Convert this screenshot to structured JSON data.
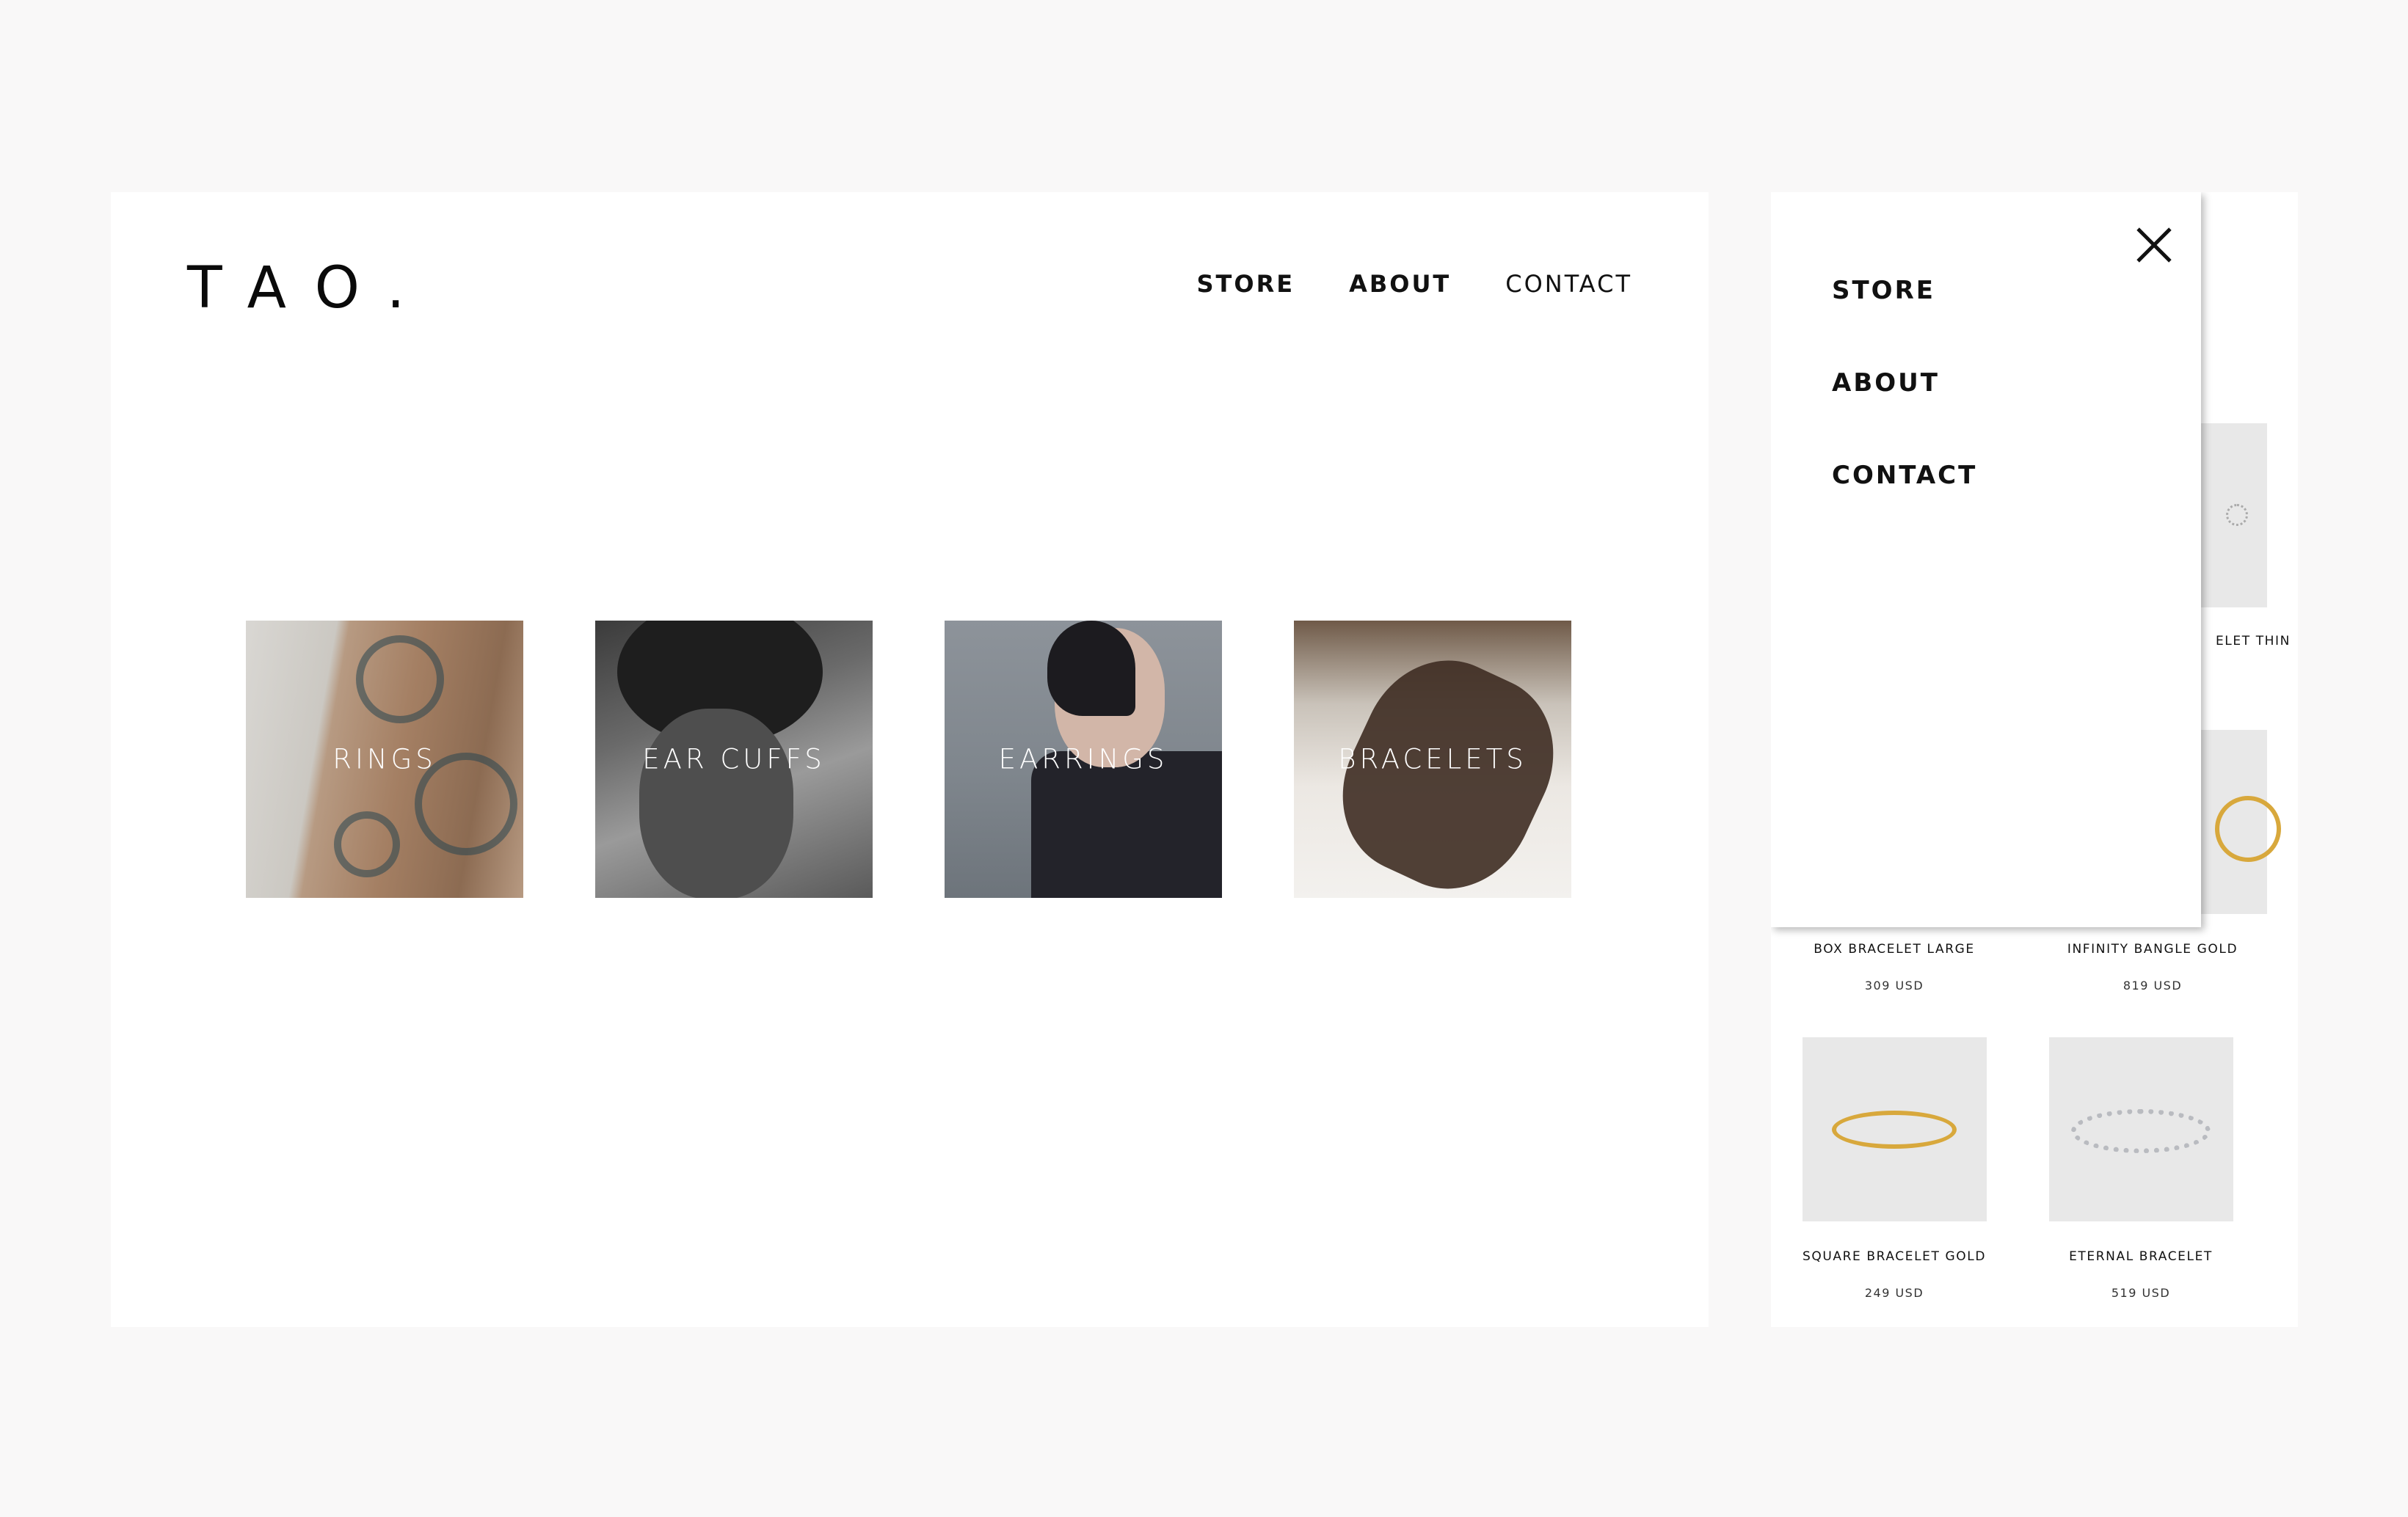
{
  "brand": {
    "logo": "TAO."
  },
  "desktop_nav": {
    "items": [
      "STORE",
      "ABOUT",
      "CONTACT"
    ]
  },
  "categories": [
    "RINGS",
    "EAR CUFFS",
    "EARRINGS",
    "BRACELETS"
  ],
  "mobile_menu": {
    "close_icon": "close-icon",
    "items": [
      "STORE",
      "ABOUT",
      "CONTACT"
    ]
  },
  "products": [
    {
      "name": "ELET THIN",
      "price": ""
    },
    {
      "name": "BOX BRACELET LARGE",
      "price": "309 USD"
    },
    {
      "name": "INFINITY BANGLE GOLD",
      "price": "819 USD"
    },
    {
      "name": "SQUARE BRACELET GOLD",
      "price": "249 USD"
    },
    {
      "name": "ETERNAL BRACELET",
      "price": "519 USD"
    }
  ],
  "colors": {
    "page_background": "#f9f8f8",
    "card_background": "#ffffff",
    "product_thumb": "#e8e8e8",
    "gold": "#d8a83c"
  }
}
